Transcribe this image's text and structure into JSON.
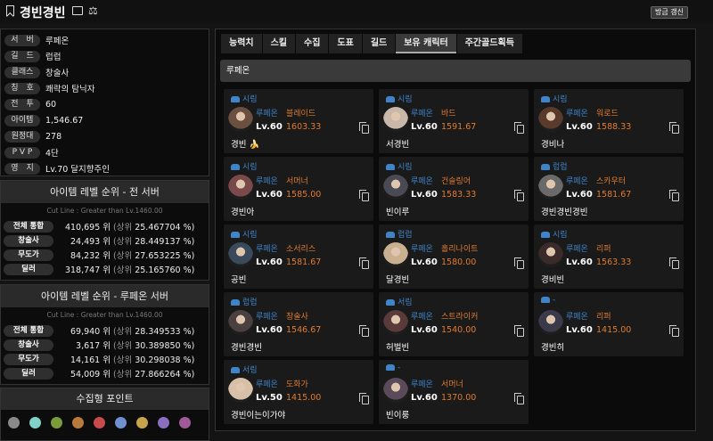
{
  "header": {
    "title": "경빈경빈",
    "update_label": "방금 갱신"
  },
  "info": [
    {
      "label": "서　버",
      "value": "루페온"
    },
    {
      "label": "길　드",
      "value": "럽럽"
    },
    {
      "label": "클래스",
      "value": "창술사"
    },
    {
      "label": "칭　호",
      "value": "쾌락의 탐닉자"
    },
    {
      "label": "전　투",
      "value": "60"
    },
    {
      "label": "아이템",
      "value": "1,546.67"
    },
    {
      "label": "원정대",
      "value": "278"
    },
    {
      "label": "P V P",
      "value": "4단"
    },
    {
      "label": "영　지",
      "value": "Lv.70 달지향주인"
    }
  ],
  "rank_all": {
    "title": "아이템 레벨 순위 - 전 서버",
    "cut": "Cut Line : Greater than Lv.1460.00",
    "rows": [
      {
        "label": "전체 통합",
        "rank": "410,695 위",
        "pct": "25.467704 %)"
      },
      {
        "label": "창술사",
        "rank": "24,493 위",
        "pct": "28.449137 %)"
      },
      {
        "label": "무도가",
        "rank": "84,232 위",
        "pct": "27.653225 %)"
      },
      {
        "label": "딜러",
        "rank": "318,747 위",
        "pct": "25.165760 %)"
      }
    ]
  },
  "rank_server": {
    "title": "아이템 레벨 순위 - 루페온 서버",
    "cut": "Cut Line : Greater than Lv.1460.00",
    "rows": [
      {
        "label": "전체 통합",
        "rank": "69,940 위",
        "pct": "28.349533 %)"
      },
      {
        "label": "창술사",
        "rank": "3,617 위",
        "pct": "30.389850 %)"
      },
      {
        "label": "무도가",
        "rank": "14,161 위",
        "pct": "30.298038 %)"
      },
      {
        "label": "딜러",
        "rank": "54,009 위",
        "pct": "27.866264 %)"
      }
    ]
  },
  "rank_prefix": "(상위",
  "collect": {
    "title": "수집형 포인트",
    "icons": [
      "#8a8a8a",
      "#7fd3c8",
      "#7a9b3a",
      "#b87a3a",
      "#c94a4a",
      "#6f8fd1",
      "#c7a34a",
      "#8a6fc1",
      "#a05a9a"
    ]
  },
  "tabs": [
    "능력치",
    "스킬",
    "수집",
    "도표",
    "길드",
    "보유 캐릭터",
    "주간골드획득"
  ],
  "active_tab": 5,
  "server_name": "루페온",
  "characters": [
    {
      "cls": "시림",
      "server": "루페온",
      "class": "블레이드",
      "lv": "Lv.60",
      "ilvl": "1603.33",
      "name": "경빈 🍌"
    },
    {
      "cls": "시림",
      "server": "루페온",
      "class": "바드",
      "lv": "Lv.60",
      "ilvl": "1591.67",
      "name": "서경빈"
    },
    {
      "cls": "시림",
      "server": "루페온",
      "class": "워로드",
      "lv": "Lv.60",
      "ilvl": "1588.33",
      "name": "경비나"
    },
    {
      "cls": "시림",
      "server": "루페온",
      "class": "서머너",
      "lv": "Lv.60",
      "ilvl": "1585.00",
      "name": "경빈아"
    },
    {
      "cls": "시림",
      "server": "루페온",
      "class": "건슬링어",
      "lv": "Lv.60",
      "ilvl": "1583.33",
      "name": "빈이루"
    },
    {
      "cls": "럽럽",
      "server": "루페온",
      "class": "스카우터",
      "lv": "Lv.60",
      "ilvl": "1581.67",
      "name": "경빈경빈경빈"
    },
    {
      "cls": "시림",
      "server": "루페온",
      "class": "소서리스",
      "lv": "Lv.60",
      "ilvl": "1581.67",
      "name": "공빈"
    },
    {
      "cls": "럽럽",
      "server": "루페온",
      "class": "홀리나이트",
      "lv": "Lv.60",
      "ilvl": "1580.00",
      "name": "달경빈"
    },
    {
      "cls": "시림",
      "server": "루페온",
      "class": "리퍼",
      "lv": "Lv.60",
      "ilvl": "1563.33",
      "name": "경비빈"
    },
    {
      "cls": "럽럽",
      "server": "루페온",
      "class": "창술사",
      "lv": "Lv.60",
      "ilvl": "1546.67",
      "name": "경빈경빈"
    },
    {
      "cls": "서림",
      "server": "루페온",
      "class": "스트라이커",
      "lv": "Lv.60",
      "ilvl": "1540.00",
      "name": "허벌빈"
    },
    {
      "cls": "-",
      "server": "루페온",
      "class": "리퍼",
      "lv": "Lv.60",
      "ilvl": "1415.00",
      "name": "경빈히"
    },
    {
      "cls": "서림",
      "server": "루페온",
      "class": "도화가",
      "lv": "Lv.50",
      "ilvl": "1415.00",
      "name": "경빈이는이가야"
    },
    {
      "cls": "-",
      "server": "루페온",
      "class": "서머너",
      "lv": "Lv.60",
      "ilvl": "1370.00",
      "name": "빈이룽"
    }
  ]
}
